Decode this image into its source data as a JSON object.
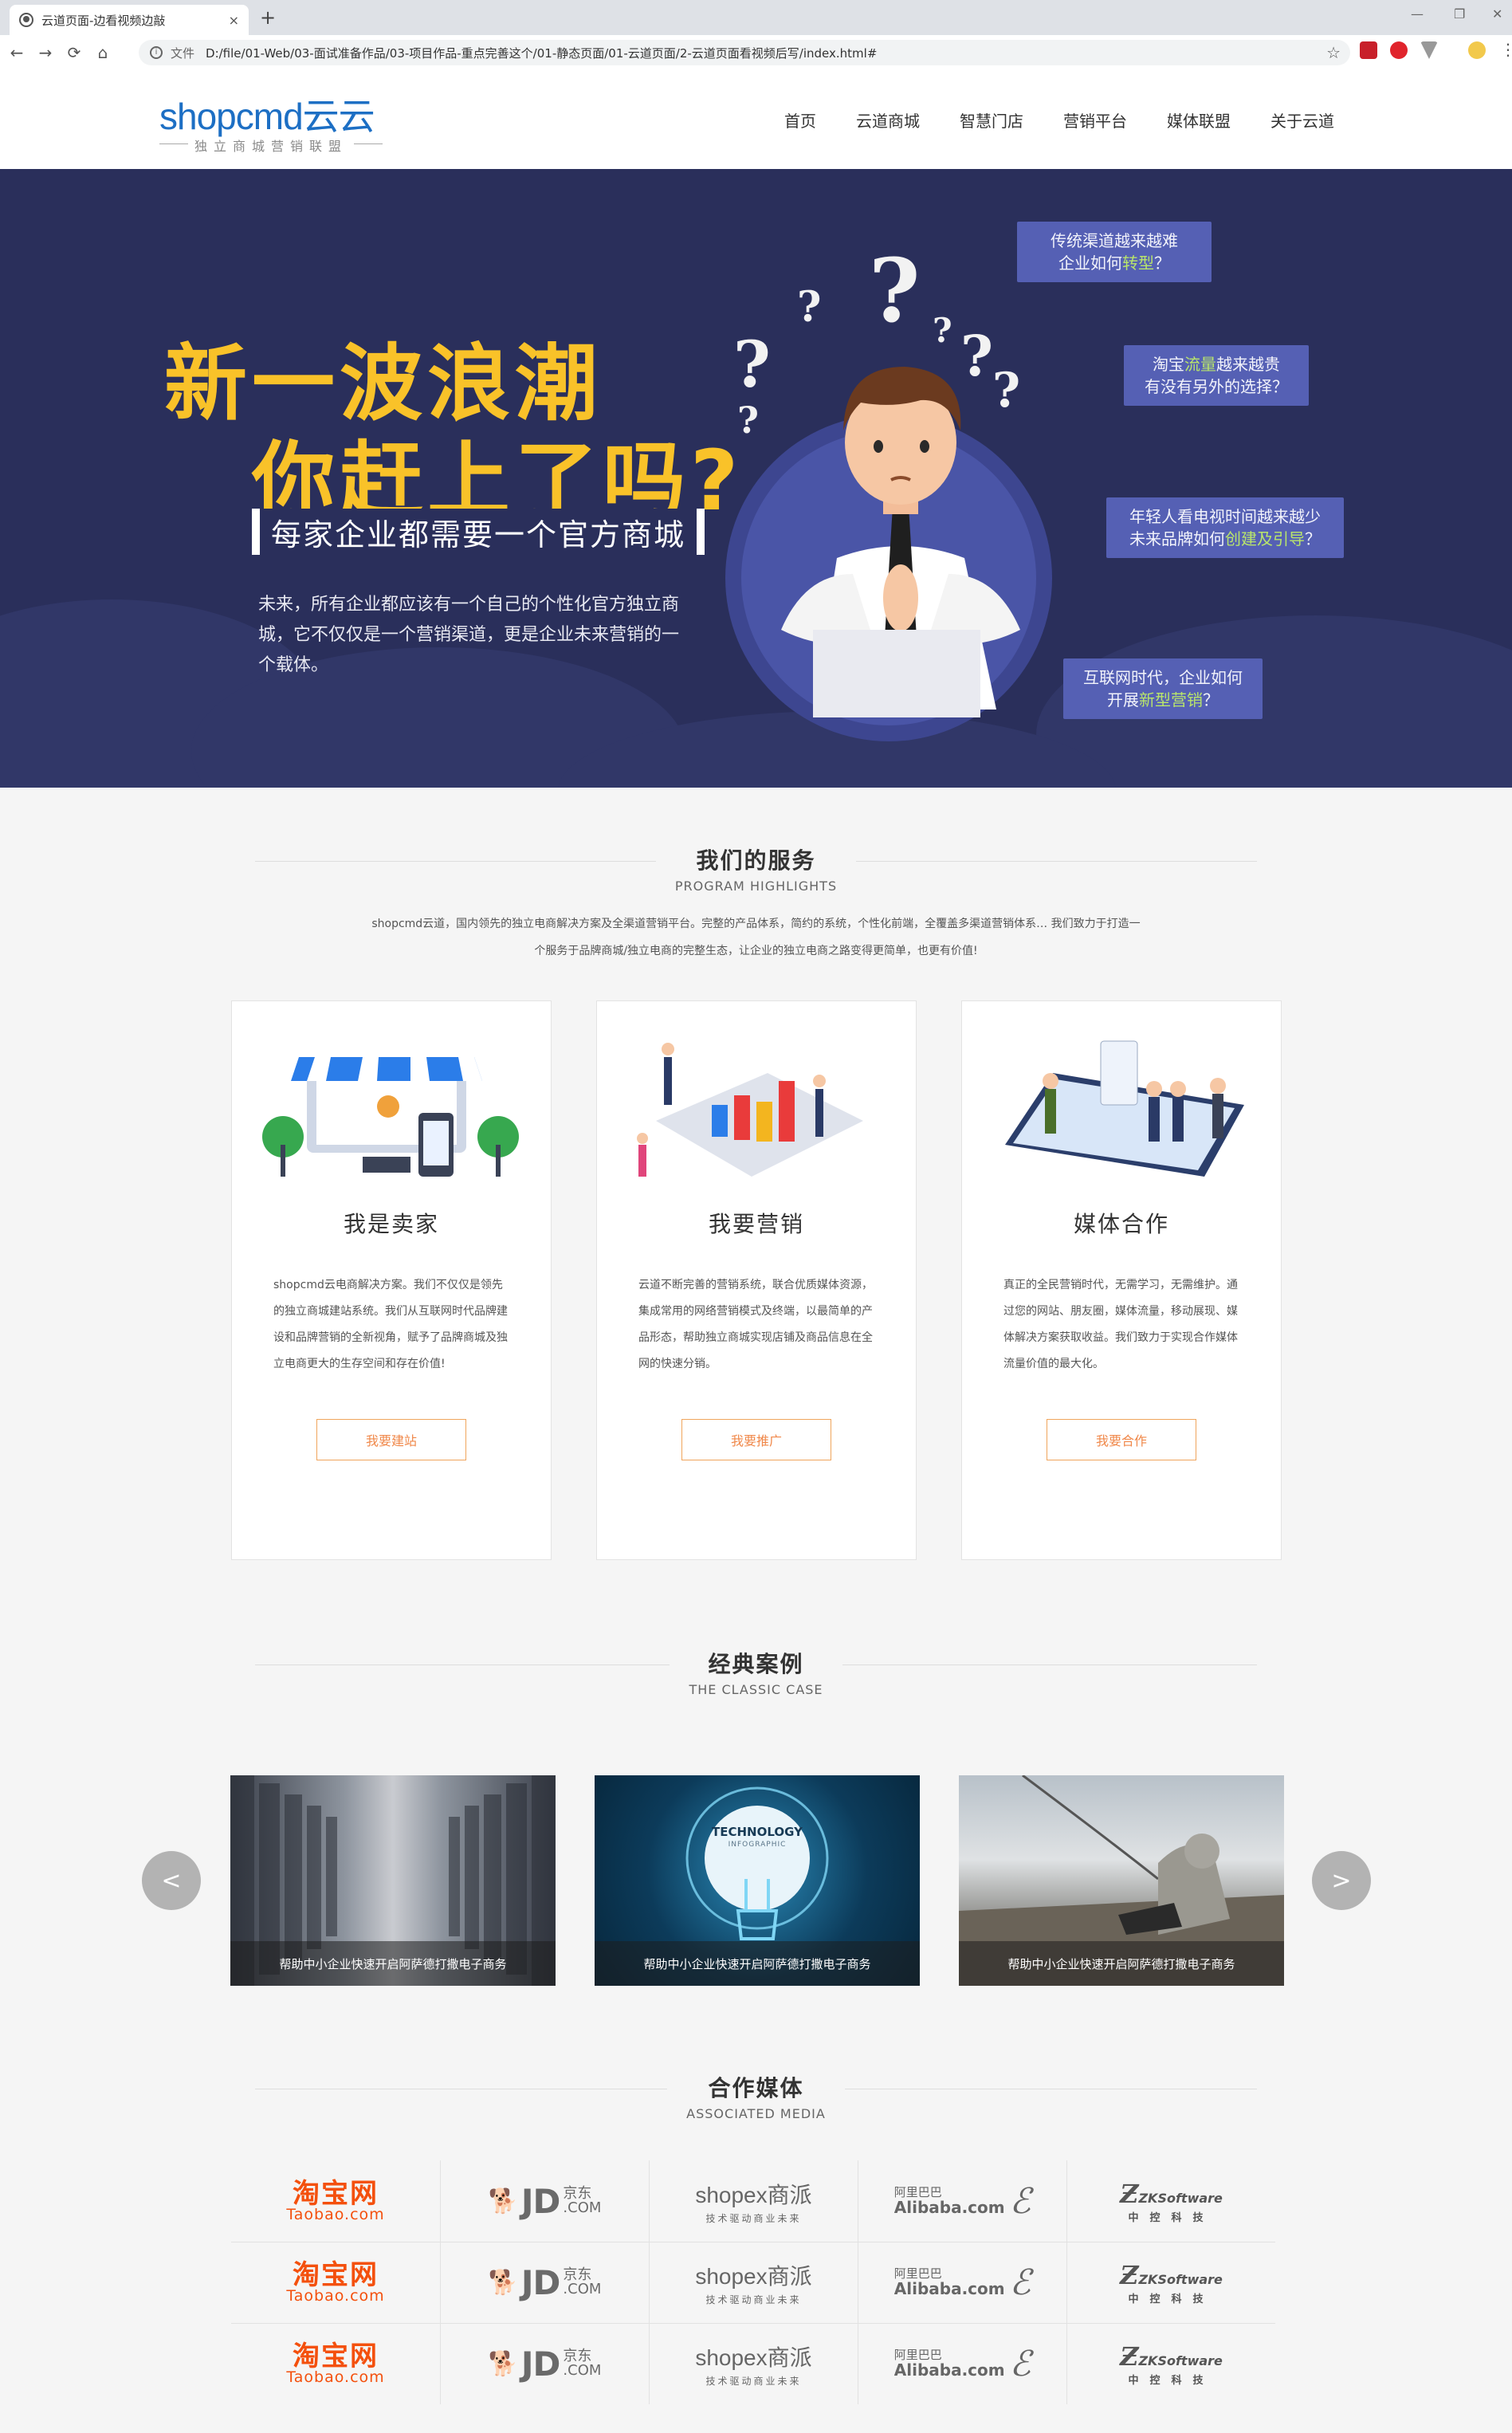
{
  "browser": {
    "tab_title": "云道页面-边看视频边敲",
    "tab_close": "×",
    "new_tab": "+",
    "win_controls": [
      "—",
      "❐",
      "✕"
    ],
    "nav": [
      "←",
      "→",
      "⟳",
      "⌂"
    ],
    "url_label": "文件",
    "url": "D:/file/01-Web/03-面试准备作品/03-项目作品-重点完善这个/01-静态页面/01-云道页面/2-云道页面看视频后写/index.html#",
    "star": "☆",
    "info_icon": "i"
  },
  "header": {
    "logo_main": "shopcmd云云",
    "logo_sub": "独立商城营销联盟",
    "nav": [
      "首页",
      "云道商城",
      "智慧门店",
      "营销平台",
      "媒体联盟",
      "关于云道"
    ]
  },
  "hero": {
    "headline_1": "新一波浪潮",
    "headline_2": "你赶上了吗?",
    "tag": "每家企业都需要一个官方商城",
    "desc": "未来，所有企业都应该有一个自己的个性化官方独立商城，它不仅仅是一个营销渠道，更是企业未来营销的一个载体。",
    "bubbles": [
      {
        "l1": "传统渠道越来越难",
        "l2a": "企业如何",
        "hl": "转型",
        "l2b": "？"
      },
      {
        "l1a": "淘宝",
        "hl": "流量",
        "l1b": "越来越贵",
        "l2": "有没有另外的选择？"
      },
      {
        "l1": "年轻人看电视时间越来越少",
        "l2a": "未来品牌如何",
        "hl": "创建及引导",
        "l2b": "？"
      },
      {
        "l1": "互联网时代，企业如何",
        "l2a": "开展",
        "hl": "新型营销",
        "l2b": "？"
      }
    ],
    "qmark": "?"
  },
  "services": {
    "title": "我们的服务",
    "subtitle": "PROGRAM HIGHLIGHTS",
    "intro_1": "shopcmd云道，国内领先的独立电商解决方案及全渠道营销平台。完整的产品体系，简约的系统，个性化前端，全覆盖多渠道营销体系… 我们致力于打造一",
    "intro_2": "个服务于品牌商城/独立电商的完整生态，让企业的独立电商之路变得更简单，也更有价值!",
    "cards": [
      {
        "title": "我是卖家",
        "desc": "shopcmd云电商解决方案。我们不仅仅是领先的独立商城建站系统。我们从互联网时代品牌建设和品牌营销的全新视角，赋予了品牌商城及独立电商更大的生存空间和存在价值!",
        "button": "我要建站"
      },
      {
        "title": "我要营销",
        "desc": "云道不断完善的营销系统，联合优质媒体资源，集成常用的网络营销模式及终端，以最简单的产品形态，帮助独立商城实现店铺及商品信息在全网的快速分销。",
        "button": "我要推广"
      },
      {
        "title": "媒体合作",
        "desc": "真正的全民营销时代，无需学习，无需维护。通过您的网站、朋友圈，媒体流量，移动展现、媒体解决方案获取收益。我们致力于实现合作媒体流量价值的最大化。",
        "button": "我要合作"
      }
    ]
  },
  "cases": {
    "title": "经典案例",
    "subtitle": "THE CLASSIC CASE",
    "prev": "<",
    "next": ">",
    "items": [
      {
        "caption": "帮助中小企业快速开启阿萨德打撒电子商务"
      },
      {
        "caption": "帮助中小企业快速开启阿萨德打撒电子商务",
        "badge_1": "TECHNOLOGY",
        "badge_2": "INFOGRAPHIC"
      },
      {
        "caption": "帮助中小企业快速开启阿萨德打撒电子商务"
      }
    ]
  },
  "media": {
    "title": "合作媒体",
    "subtitle": "ASSOCIATED MEDIA",
    "logos": {
      "taobao_a": "淘宝网",
      "taobao_b": "Taobao.com",
      "jd_a": "JD",
      "jd_cn": "京东",
      "jd_com": ".COM",
      "shopex_a": "shopex商派",
      "shopex_b": "技术驱动商业未来",
      "ali_a": "阿里巴巴",
      "ali_b": "Alibaba.com",
      "zk_a": "ZKSoftware",
      "zk_b": "中控科技"
    }
  }
}
